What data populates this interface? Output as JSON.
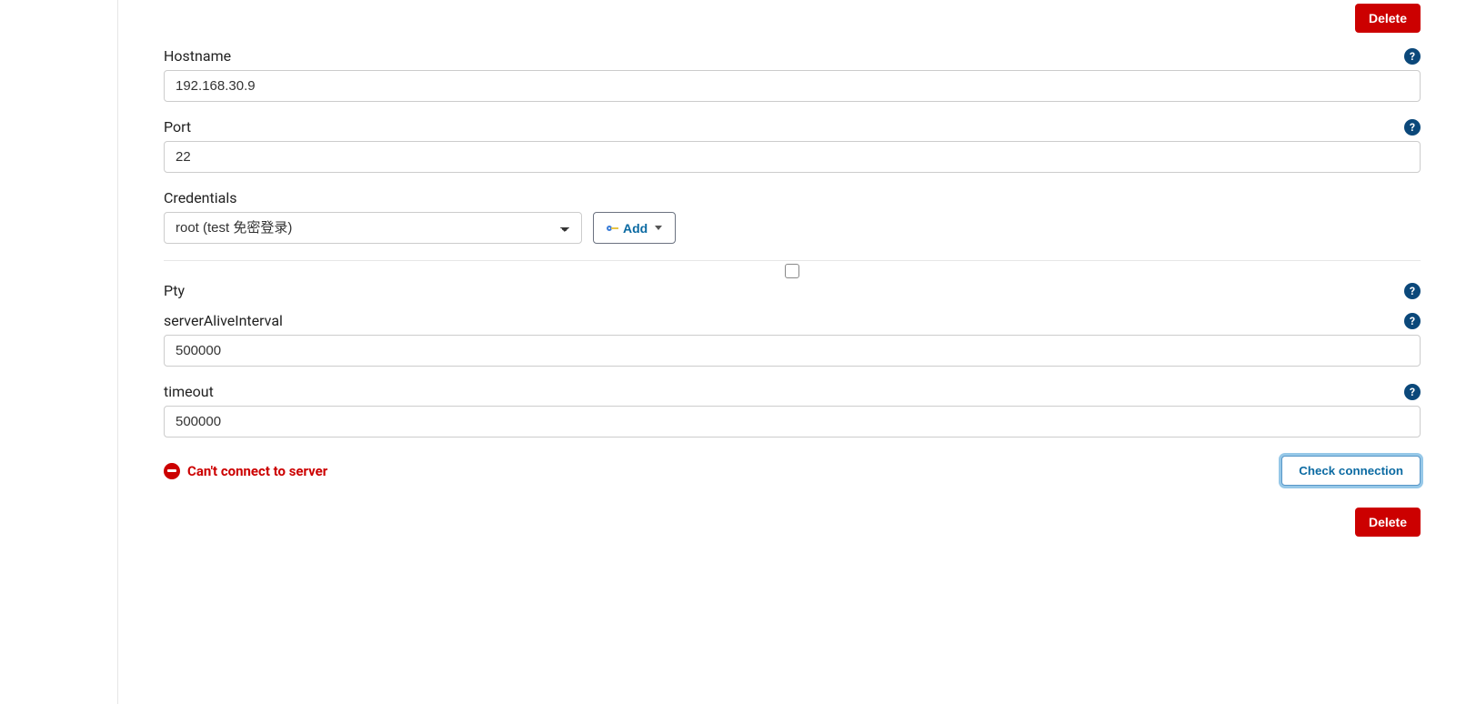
{
  "buttons": {
    "delete_top": "Delete",
    "add": "Add",
    "check_connection": "Check connection",
    "delete_bottom": "Delete"
  },
  "form": {
    "hostname": {
      "label": "Hostname",
      "value": "192.168.30.9"
    },
    "port": {
      "label": "Port",
      "value": "22"
    },
    "credentials": {
      "label": "Credentials",
      "selected": "root (test 免密登录)"
    },
    "pty": {
      "label": "Pty",
      "checked": false
    },
    "serverAliveInterval": {
      "label": "serverAliveInterval",
      "value": "500000"
    },
    "timeout": {
      "label": "timeout",
      "value": "500000"
    }
  },
  "status": {
    "error": "Can't connect to server"
  }
}
